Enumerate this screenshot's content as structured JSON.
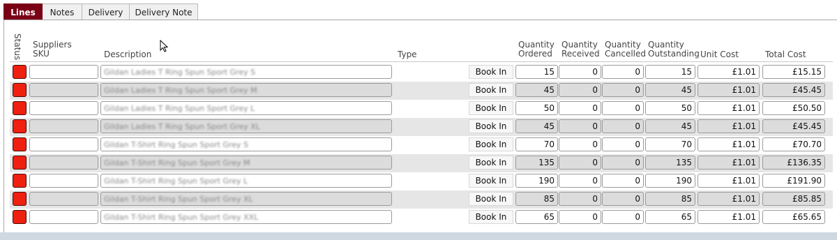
{
  "tabs": [
    {
      "label": "Lines",
      "active": true
    },
    {
      "label": "Notes",
      "active": false
    },
    {
      "label": "Delivery",
      "active": false
    },
    {
      "label": "Delivery Note",
      "active": false
    }
  ],
  "columns": {
    "status": "Status",
    "sku_line1": "Suppliers",
    "sku_line2": "SKU",
    "description": "Description",
    "type": "Type",
    "qty_ordered_line1": "Quantity",
    "qty_ordered_line2": "Ordered",
    "qty_received_line1": "Quantity",
    "qty_received_line2": "Received",
    "qty_cancelled_line1": "Quantity",
    "qty_cancelled_line2": "Cancelled",
    "qty_outstanding_line1": "Quantity",
    "qty_outstanding_line2": "Outstanding",
    "unit_cost": "Unit Cost",
    "total_cost": "Total Cost"
  },
  "book_in_label": "Book In",
  "status_color": "#f02010",
  "accent_color": "#7a0016",
  "rows": [
    {
      "description": "Gildan Ladies T Ring Spun Sport Grey S",
      "ordered": "15",
      "received": "0",
      "cancelled": "0",
      "outstanding": "15",
      "unit_cost": "£1.01",
      "total_cost": "£15.15"
    },
    {
      "description": "Gildan Ladies T Ring Spun Sport Grey M",
      "ordered": "45",
      "received": "0",
      "cancelled": "0",
      "outstanding": "45",
      "unit_cost": "£1.01",
      "total_cost": "£45.45"
    },
    {
      "description": "Gildan Ladies T Ring Spun Sport Grey L",
      "ordered": "50",
      "received": "0",
      "cancelled": "0",
      "outstanding": "50",
      "unit_cost": "£1.01",
      "total_cost": "£50.50"
    },
    {
      "description": "Gildan Ladies T Ring Spun Sport Grey XL",
      "ordered": "45",
      "received": "0",
      "cancelled": "0",
      "outstanding": "45",
      "unit_cost": "£1.01",
      "total_cost": "£45.45"
    },
    {
      "description": "Gildan T-Shirt Ring Spun Sport Grey S",
      "ordered": "70",
      "received": "0",
      "cancelled": "0",
      "outstanding": "70",
      "unit_cost": "£1.01",
      "total_cost": "£70.70"
    },
    {
      "description": "Gildan T-Shirt Ring Spun Sport Grey M",
      "ordered": "135",
      "received": "0",
      "cancelled": "0",
      "outstanding": "135",
      "unit_cost": "£1.01",
      "total_cost": "£136.35"
    },
    {
      "description": "Gildan T-Shirt Ring Spun Sport Grey L",
      "ordered": "190",
      "received": "0",
      "cancelled": "0",
      "outstanding": "190",
      "unit_cost": "£1.01",
      "total_cost": "£191.90"
    },
    {
      "description": "Gildan T-Shirt Ring Spun Sport Grey XL",
      "ordered": "85",
      "received": "0",
      "cancelled": "0",
      "outstanding": "85",
      "unit_cost": "£1.01",
      "total_cost": "£85.85"
    },
    {
      "description": "Gildan T-Shirt Ring Spun Sport Grey XXL",
      "ordered": "65",
      "received": "0",
      "cancelled": "0",
      "outstanding": "65",
      "unit_cost": "£1.01",
      "total_cost": "£65.65"
    }
  ]
}
